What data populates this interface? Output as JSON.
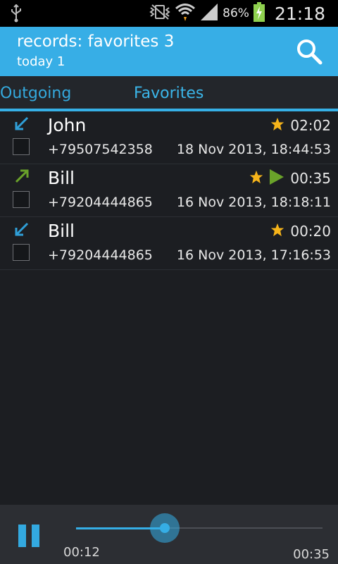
{
  "status_bar": {
    "battery_percent": "86%",
    "time": "21:18",
    "icons": [
      "usb-icon",
      "vibrate-icon",
      "wifi-icon",
      "signal-icon",
      "battery-charging-icon"
    ]
  },
  "header": {
    "title": "records: favorites 3",
    "subtitle": "today 1",
    "search_icon": "search-icon"
  },
  "tabs": [
    {
      "label": "Outgoing"
    },
    {
      "label": "Favorites"
    }
  ],
  "records": [
    {
      "name": "John",
      "phone": "+79507542358",
      "datetime": "18 Nov 2013, 18:44:53",
      "duration": "02:02",
      "direction": "incoming",
      "favorite": true,
      "playing": false
    },
    {
      "name": "Bill",
      "phone": "+79204444865",
      "datetime": "16 Nov 2013, 18:18:11",
      "duration": "00:35",
      "direction": "outgoing",
      "favorite": true,
      "playing": true
    },
    {
      "name": "Bill",
      "phone": "+79204444865",
      "datetime": "16 Nov 2013, 17:16:53",
      "duration": "00:20",
      "direction": "incoming",
      "favorite": true,
      "playing": false
    }
  ],
  "player": {
    "current_time": "00:12",
    "total_time": "00:35",
    "progress_fraction": 0.36
  },
  "colors": {
    "accent": "#35aee6",
    "incoming_arrow": "#2f9fd8",
    "outgoing_arrow": "#6aa22a",
    "star": "#f6b41a",
    "play": "#6aa22a"
  }
}
